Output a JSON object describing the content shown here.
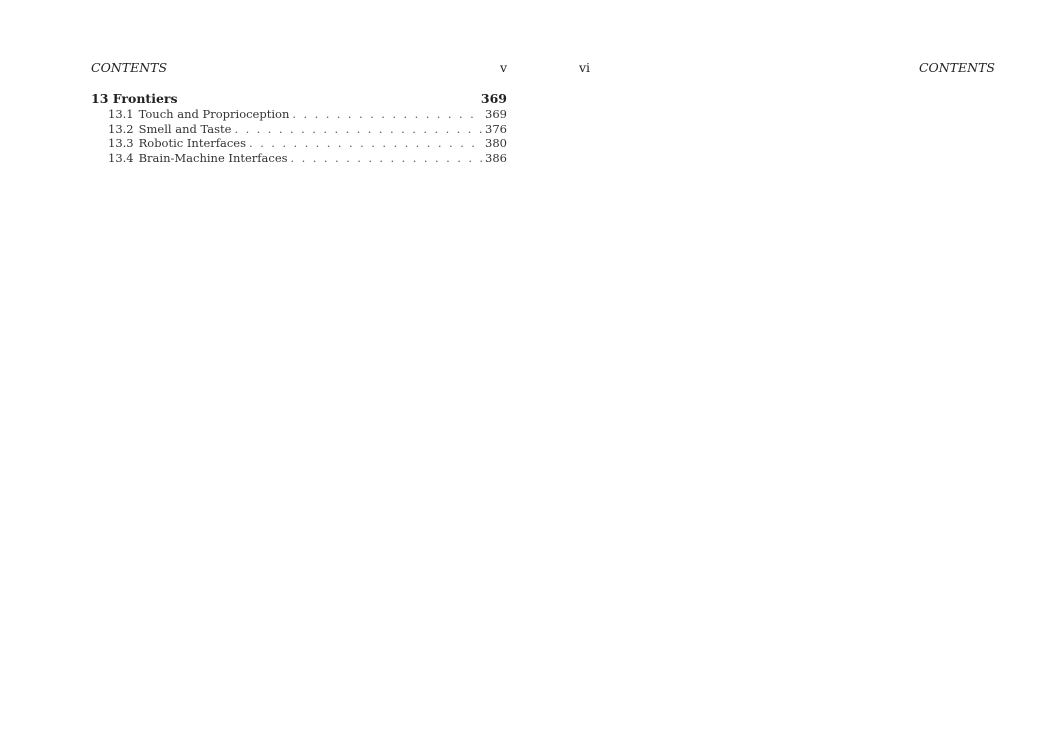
{
  "left_page": {
    "running_head": "CONTENTS",
    "page_number": "v",
    "toc": {
      "chapter": {
        "number": "13",
        "title": "Frontiers",
        "page": "369"
      },
      "sections": [
        {
          "number": "13.1",
          "title": "Touch and Proprioception",
          "page": "369"
        },
        {
          "number": "13.2",
          "title": "Smell and Taste",
          "page": "376"
        },
        {
          "number": "13.3",
          "title": "Robotic Interfaces",
          "page": "380"
        },
        {
          "number": "13.4",
          "title": "Brain-Machine Interfaces",
          "page": "386"
        }
      ]
    }
  },
  "right_page": {
    "page_number": "vi",
    "running_head": "CONTENTS"
  }
}
